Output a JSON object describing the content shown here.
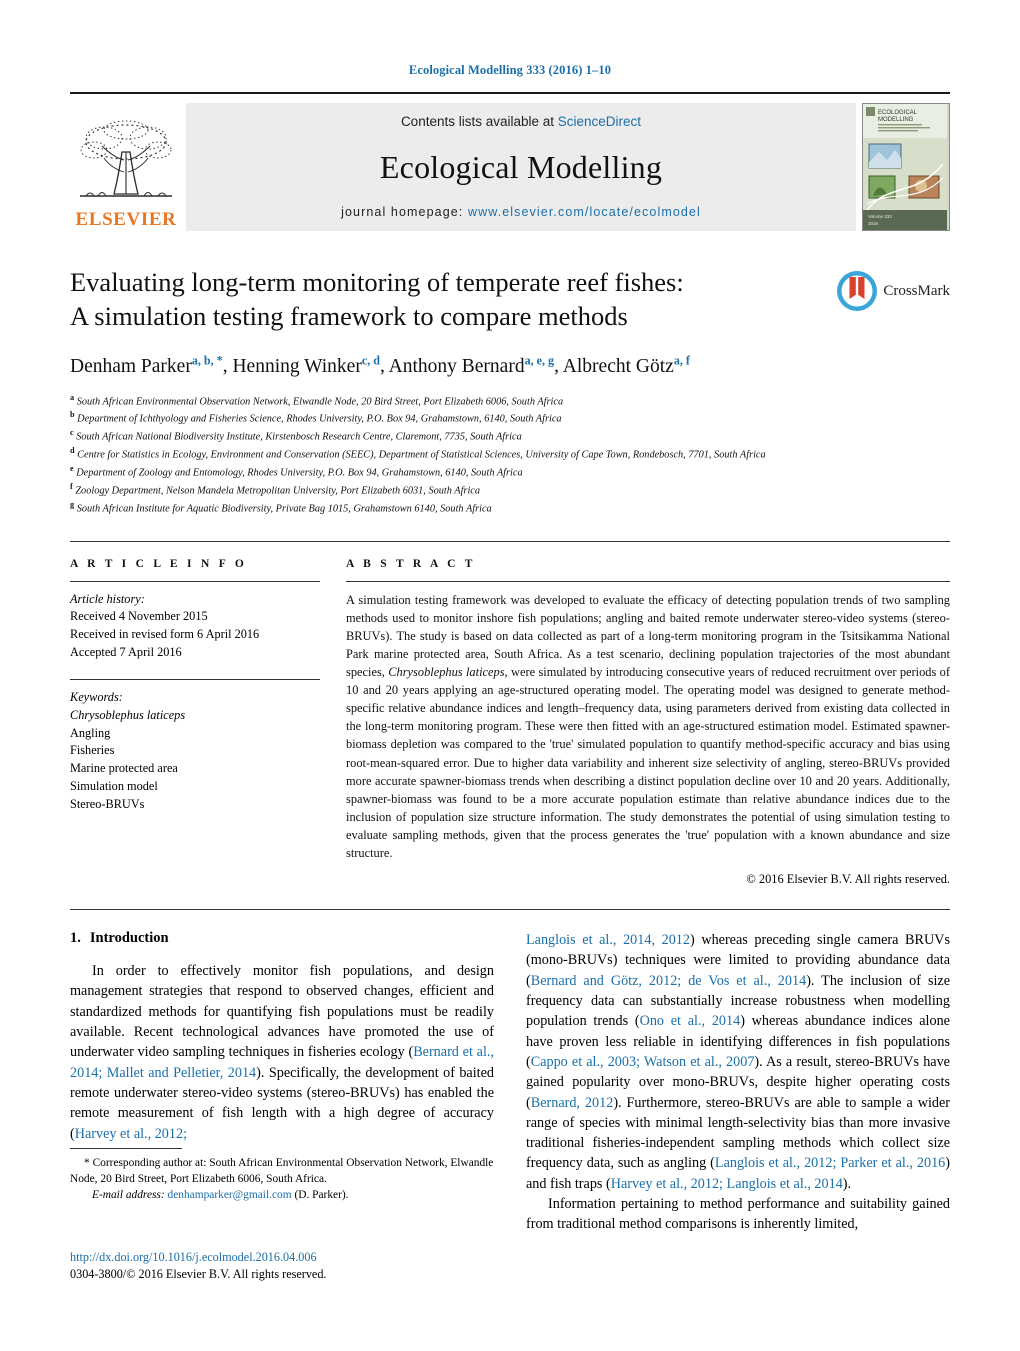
{
  "running_head": "Ecological Modelling 333 (2016) 1–10",
  "banner": {
    "publisher_name": "ELSEVIER",
    "contents_prefix": "Contents lists available at ",
    "contents_link": "ScienceDirect",
    "journal_title": "Ecological Modelling",
    "homepage_prefix": "journal homepage: ",
    "homepage_url": "www.elsevier.com/locate/ecolmodel",
    "cover_title_line1": "ECOLOGICAL",
    "cover_title_line2": "MODELLING"
  },
  "crossmark": {
    "label": "CrossMark"
  },
  "title": {
    "line1": "Evaluating long-term monitoring of temperate reef fishes:",
    "line2": "A simulation testing framework to compare methods"
  },
  "authors": [
    {
      "name": "Denham Parker",
      "sup": "a, b, *"
    },
    {
      "name": "Henning Winker",
      "sup": "c, d"
    },
    {
      "name": "Anthony Bernard",
      "sup": "a, e, g"
    },
    {
      "name": "Albrecht Götz",
      "sup": "a, f"
    }
  ],
  "affiliations": [
    {
      "mark": "a",
      "text": "South African Environmental Observation Network, Elwandle Node, 20 Bird Street, Port Elizabeth 6006, South Africa"
    },
    {
      "mark": "b",
      "text": "Department of Ichthyology and Fisheries Science, Rhodes University, P.O. Box 94, Grahamstown, 6140, South Africa"
    },
    {
      "mark": "c",
      "text": "South African National Biodiversity Institute, Kirstenbosch Research Centre, Claremont, 7735, South Africa"
    },
    {
      "mark": "d",
      "text": "Centre for Statistics in Ecology, Environment and Conservation (SEEC), Department of Statistical Sciences, University of Cape Town, Rondebosch, 7701, South Africa"
    },
    {
      "mark": "e",
      "text": "Department of Zoology and Entomology, Rhodes University, P.O. Box 94, Grahamstown, 6140, South Africa"
    },
    {
      "mark": "f",
      "text": "Zoology Department, Nelson Mandela Metropolitan University, Port Elizabeth 6031, South Africa"
    },
    {
      "mark": "g",
      "text": "South African Institute for Aquatic Biodiversity, Private Bag 1015, Grahamstown 6140, South Africa"
    }
  ],
  "article_info": {
    "heading": "A R T I C L E   I N F O",
    "history_label": "Article history:",
    "history": [
      "Received 4 November 2015",
      "Received in revised form 6 April 2016",
      "Accepted 7 April 2016"
    ],
    "keywords_label": "Keywords:",
    "keywords": [
      "Chrysoblephus laticeps",
      "Angling",
      "Fisheries",
      "Marine protected area",
      "Simulation model",
      "Stereo-BRUVs"
    ],
    "keywords_italic_index": 0
  },
  "abstract": {
    "heading": "A B S T R A C T",
    "paragraph_part1": "A simulation testing framework was developed to evaluate the efficacy of detecting population trends of two sampling methods used to monitor inshore fish populations; angling and baited remote underwater stereo-video systems (stereo-BRUVs). The study is based on data collected as part of a long-term monitoring program in the Tsitsikamma National Park marine protected area, South Africa. As a test scenario, declining population trajectories of the most abundant species, ",
    "species_italic": "Chrysoblephus laticeps",
    "paragraph_part2": ", were simulated by introducing consecutive years of reduced recruitment over periods of 10 and 20 years applying an age-structured operating model. The operating model was designed to generate method-specific relative abundance indices and length–frequency data, using parameters derived from existing data collected in the long-term monitoring program. These were then fitted with an age-structured estimation model. Estimated spawner-biomass depletion was compared to the 'true' simulated population to quantify method-specific accuracy and bias using root-mean-squared error. Due to higher data variability and inherent size selectivity of angling, stereo-BRUVs provided more accurate spawner-biomass trends when describing a distinct population decline over 10 and 20 years. Additionally, spawner-biomass was found to be a more accurate population estimate than relative abundance indices due to the inclusion of population size structure information. The study demonstrates the potential of using simulation testing to evaluate sampling methods, given that the process generates the 'true' population with a known abundance and size structure.",
    "copyright": "© 2016 Elsevier B.V. All rights reserved."
  },
  "introduction": {
    "number": "1.",
    "title": "Introduction",
    "left_para_segments": [
      {
        "type": "text",
        "value": "In order to effectively monitor fish populations, and design management strategies that respond to observed changes, efficient and standardized methods for quantifying fish populations must be readily available. Recent technological advances have promoted the use of underwater video sampling techniques in fisheries ecology ("
      },
      {
        "type": "ref",
        "value": "Bernard et al., 2014; Mallet and Pelletier, 2014"
      },
      {
        "type": "text",
        "value": "). Specifically, the development of baited remote underwater stereo-video systems (stereo-BRUVs) has enabled the remote measurement of fish length with a high degree of accuracy ("
      },
      {
        "type": "ref",
        "value": "Harvey et al., 2012;"
      }
    ],
    "right_para1_segments": [
      {
        "type": "ref",
        "value": "Langlois et al., 2014, 2012"
      },
      {
        "type": "text",
        "value": ") whereas preceding single camera BRUVs (mono-BRUVs) techniques were limited to providing abundance data ("
      },
      {
        "type": "ref",
        "value": "Bernard and Götz, 2012; de Vos et al., 2014"
      },
      {
        "type": "text",
        "value": "). The inclusion of size frequency data can substantially increase robustness when modelling population trends ("
      },
      {
        "type": "ref",
        "value": "Ono et al., 2014"
      },
      {
        "type": "text",
        "value": ") whereas abundance indices alone have proven less reliable in identifying differences in fish populations ("
      },
      {
        "type": "ref",
        "value": "Cappo et al., 2003; Watson et al., 2007"
      },
      {
        "type": "text",
        "value": "). As a result, stereo-BRUVs have gained popularity over mono-BRUVs, despite higher operating costs ("
      },
      {
        "type": "ref",
        "value": "Bernard, 2012"
      },
      {
        "type": "text",
        "value": "). Furthermore, stereo-BRUVs are able to sample a wider range of species with minimal length-selectivity bias than more invasive traditional fisheries-independent sampling methods which collect size frequency data, such as angling ("
      },
      {
        "type": "ref",
        "value": "Langlois et al., 2012; Parker et al., 2016"
      },
      {
        "type": "text",
        "value": ") and fish traps ("
      },
      {
        "type": "ref",
        "value": "Harvey et al., 2012; Langlois et al., 2014"
      },
      {
        "type": "text",
        "value": ")."
      }
    ],
    "right_para2": "Information pertaining to method performance and suitability gained from traditional method comparisons is inherently limited,"
  },
  "footnote": {
    "marker": "*",
    "corresponding_text": "Corresponding author at: South African Environmental Observation Network, Elwandle Node, 20 Bird Street, Port Elizabeth 6006, South Africa.",
    "email_label": "E-mail address:",
    "email": "denhamparker@gmail.com",
    "email_suffix": "(D. Parker)."
  },
  "doi_block": {
    "doi_url": "http://dx.doi.org/10.1016/j.ecolmodel.2016.04.006",
    "issn_line": "0304-3800/© 2016 Elsevier B.V. All rights reserved."
  },
  "colors": {
    "link_blue": "#1b6fa8",
    "elsevier_orange": "#e87722",
    "banner_grey": "#ececec"
  }
}
